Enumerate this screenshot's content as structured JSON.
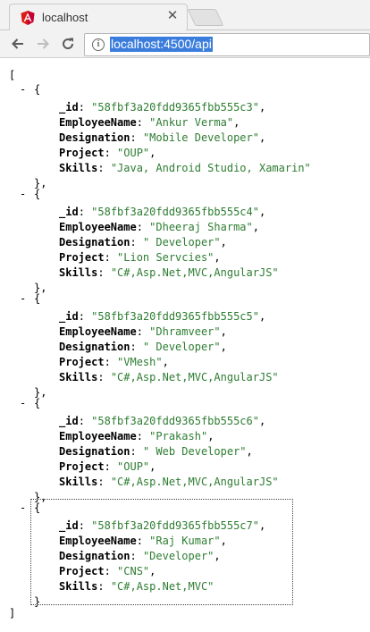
{
  "tab": {
    "title": "localhost"
  },
  "address_bar": {
    "url": "localhost:4500/api"
  },
  "json": {
    "open_bracket": "[",
    "close_bracket": "]",
    "open_brace": "{",
    "close_brace": "},",
    "last_close_brace": "}",
    "toggle_symbol": "-",
    "records": [
      {
        "id": "58fbf3a20fdd9365fbb555c3",
        "name": "Ankur Verma",
        "designation": "Mobile Developer",
        "project": "OUP",
        "skills": "Java, Android Studio, Xamarin"
      },
      {
        "id": "58fbf3a20fdd9365fbb555c4",
        "name": "Dheeraj Sharma",
        "designation": " Developer",
        "project": "Lion Servcies",
        "skills": "C#,Asp.Net,MVC,AngularJS"
      },
      {
        "id": "58fbf3a20fdd9365fbb555c5",
        "name": "Dhramveer",
        "designation": " Developer",
        "project": "VMesh",
        "skills": "C#,Asp.Net,MVC,AngularJS"
      },
      {
        "id": "58fbf3a20fdd9365fbb555c6",
        "name": "Prakash",
        "designation": " Web Developer",
        "project": "OUP",
        "skills": "C#,Asp.Net,MVC,AngularJS"
      },
      {
        "id": "58fbf3a20fdd9365fbb555c7",
        "name": "Raj Kumar",
        "designation": "Developer",
        "project": "CNS",
        "skills": "C#,Asp.Net,MVC"
      }
    ],
    "keys": {
      "id": "_id",
      "name": "EmployeeName",
      "designation": "Designation",
      "project": "Project",
      "skills": "Skills"
    }
  },
  "icons": {
    "favicon": "angular-icon",
    "back": "back-arrow-icon",
    "forward": "forward-arrow-icon",
    "reload": "reload-icon",
    "info": "info-icon",
    "close": "close-icon"
  }
}
